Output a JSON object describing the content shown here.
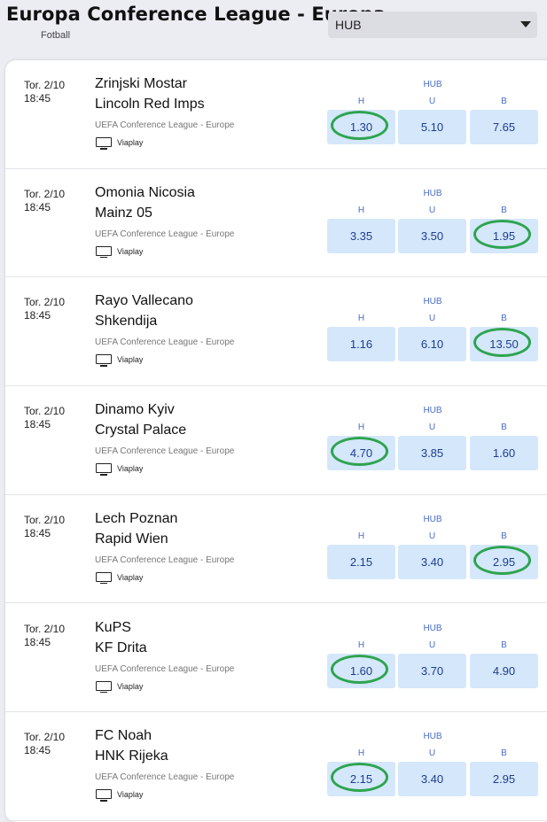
{
  "header": {
    "title": "Europa Conference League - Europa",
    "subtitle": "Fotball",
    "select_value": "HUB"
  },
  "odds_title": "HUB",
  "col_labels": [
    "H",
    "U",
    "B"
  ],
  "matches": [
    {
      "date": "Tor. 2/10",
      "time": "18:45",
      "home": "Zrinjski Mostar",
      "away": "Lincoln Red Imps",
      "league": "UEFA Conference League - Europe",
      "channel": "Viaplay",
      "odds": [
        "1.30",
        "5.10",
        "7.65"
      ],
      "circled": 0
    },
    {
      "date": "Tor. 2/10",
      "time": "18:45",
      "home": "Omonia Nicosia",
      "away": "Mainz 05",
      "league": "UEFA Conference League - Europe",
      "channel": "Viaplay",
      "odds": [
        "3.35",
        "3.50",
        "1.95"
      ],
      "circled": 2
    },
    {
      "date": "Tor. 2/10",
      "time": "18:45",
      "home": "Rayo Vallecano",
      "away": "Shkendija",
      "league": "UEFA Conference League - Europe",
      "channel": "Viaplay",
      "odds": [
        "1.16",
        "6.10",
        "13.50"
      ],
      "circled": 2
    },
    {
      "date": "Tor. 2/10",
      "time": "18:45",
      "home": "Dinamo Kyiv",
      "away": "Crystal Palace",
      "league": "UEFA Conference League - Europe",
      "channel": "Viaplay",
      "odds": [
        "4.70",
        "3.85",
        "1.60"
      ],
      "circled": 0
    },
    {
      "date": "Tor. 2/10",
      "time": "18:45",
      "home": "Lech Poznan",
      "away": "Rapid Wien",
      "league": "UEFA Conference League - Europe",
      "channel": "Viaplay",
      "odds": [
        "2.15",
        "3.40",
        "2.95"
      ],
      "circled": 2
    },
    {
      "date": "Tor. 2/10",
      "time": "18:45",
      "home": "KuPS",
      "away": "KF Drita",
      "league": "UEFA Conference League - Europe",
      "channel": "Viaplay",
      "odds": [
        "1.60",
        "3.70",
        "4.90"
      ],
      "circled": 0
    },
    {
      "date": "Tor. 2/10",
      "time": "18:45",
      "home": "FC Noah",
      "away": "HNK Rijeka",
      "league": "UEFA Conference League - Europe",
      "channel": "Viaplay",
      "odds": [
        "2.15",
        "3.40",
        "2.95"
      ],
      "circled": 0
    }
  ],
  "colors": {
    "odds_bg": "#d4e7fb",
    "odds_text": "#1d3d8f",
    "circle": "#2ea44f",
    "label": "#4a6cc7"
  },
  "icons": {
    "tv": "tv-icon",
    "caret": "chevron-down-icon"
  }
}
